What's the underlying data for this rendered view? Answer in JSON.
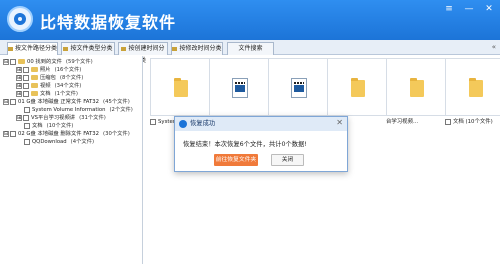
{
  "app": {
    "title": "比特数据恢复软件",
    "accent": "#1c74d8",
    "title_bar_color": "#2f8ef0"
  },
  "window_controls": [
    {
      "name": "menu-icon",
      "glyph": "≡"
    },
    {
      "name": "minimize-icon",
      "glyph": "—"
    },
    {
      "name": "close-icon",
      "glyph": "✕"
    }
  ],
  "tabs": [
    {
      "label": "按文件路径分类"
    },
    {
      "label": "按文件类型分类"
    },
    {
      "label": "按创建时间分类"
    },
    {
      "label": "按修改时间分类"
    },
    {
      "label": "文件搜索"
    }
  ],
  "collapse_glyph": "«",
  "tree": [
    {
      "label": "00 找到的文件",
      "count": "(59个文件)",
      "level": 0,
      "expander": "⊟"
    },
    {
      "label": "照片",
      "count": "(16个文件)",
      "level": 1,
      "expander": "⊞"
    },
    {
      "label": "压缩包",
      "count": "(8个文件)",
      "level": 1,
      "expander": "⊞"
    },
    {
      "label": "视频",
      "count": "(34个文件)",
      "level": 1,
      "expander": "⊞"
    },
    {
      "label": "文档",
      "count": "(1个文件)",
      "level": 1,
      "expander": "⊞"
    },
    {
      "label": "01 G盘 本地磁盘 正常文件 FAT32",
      "count": "(45个文件)",
      "level": 0,
      "expander": "⊟"
    },
    {
      "label": "System Volume Information",
      "count": "(2个文件)",
      "level": 1,
      "expander": ""
    },
    {
      "label": "VS平台学习视频讲",
      "count": "(31个文件)",
      "level": 1,
      "expander": "⊞"
    },
    {
      "label": "文档",
      "count": "(10个文件)",
      "level": 1,
      "expander": ""
    },
    {
      "label": "02 G盘 本地磁盘 删除文件 FAT32",
      "count": "(30个文件)",
      "level": 0,
      "expander": "⊟"
    },
    {
      "label": "QQDownload",
      "count": "(4个文件)",
      "level": 1,
      "expander": ""
    }
  ],
  "files": [
    {
      "type": "folder",
      "label": "System"
    },
    {
      "type": "video",
      "label": ""
    },
    {
      "type": "video",
      "label": ""
    },
    {
      "type": "folder",
      "label": ""
    },
    {
      "type": "folder",
      "label": "台学习视频..."
    },
    {
      "type": "folder",
      "label": "文档 (10个文件)"
    }
  ],
  "dialog": {
    "title": "恢复成功",
    "message": "恢复结束！本次恢复6个文件，共计0个数据!",
    "primary_button": "前往恢复文件夹",
    "secondary_button": "关闭",
    "close_glyph": "✕",
    "primary_color": "#f07a3a"
  }
}
